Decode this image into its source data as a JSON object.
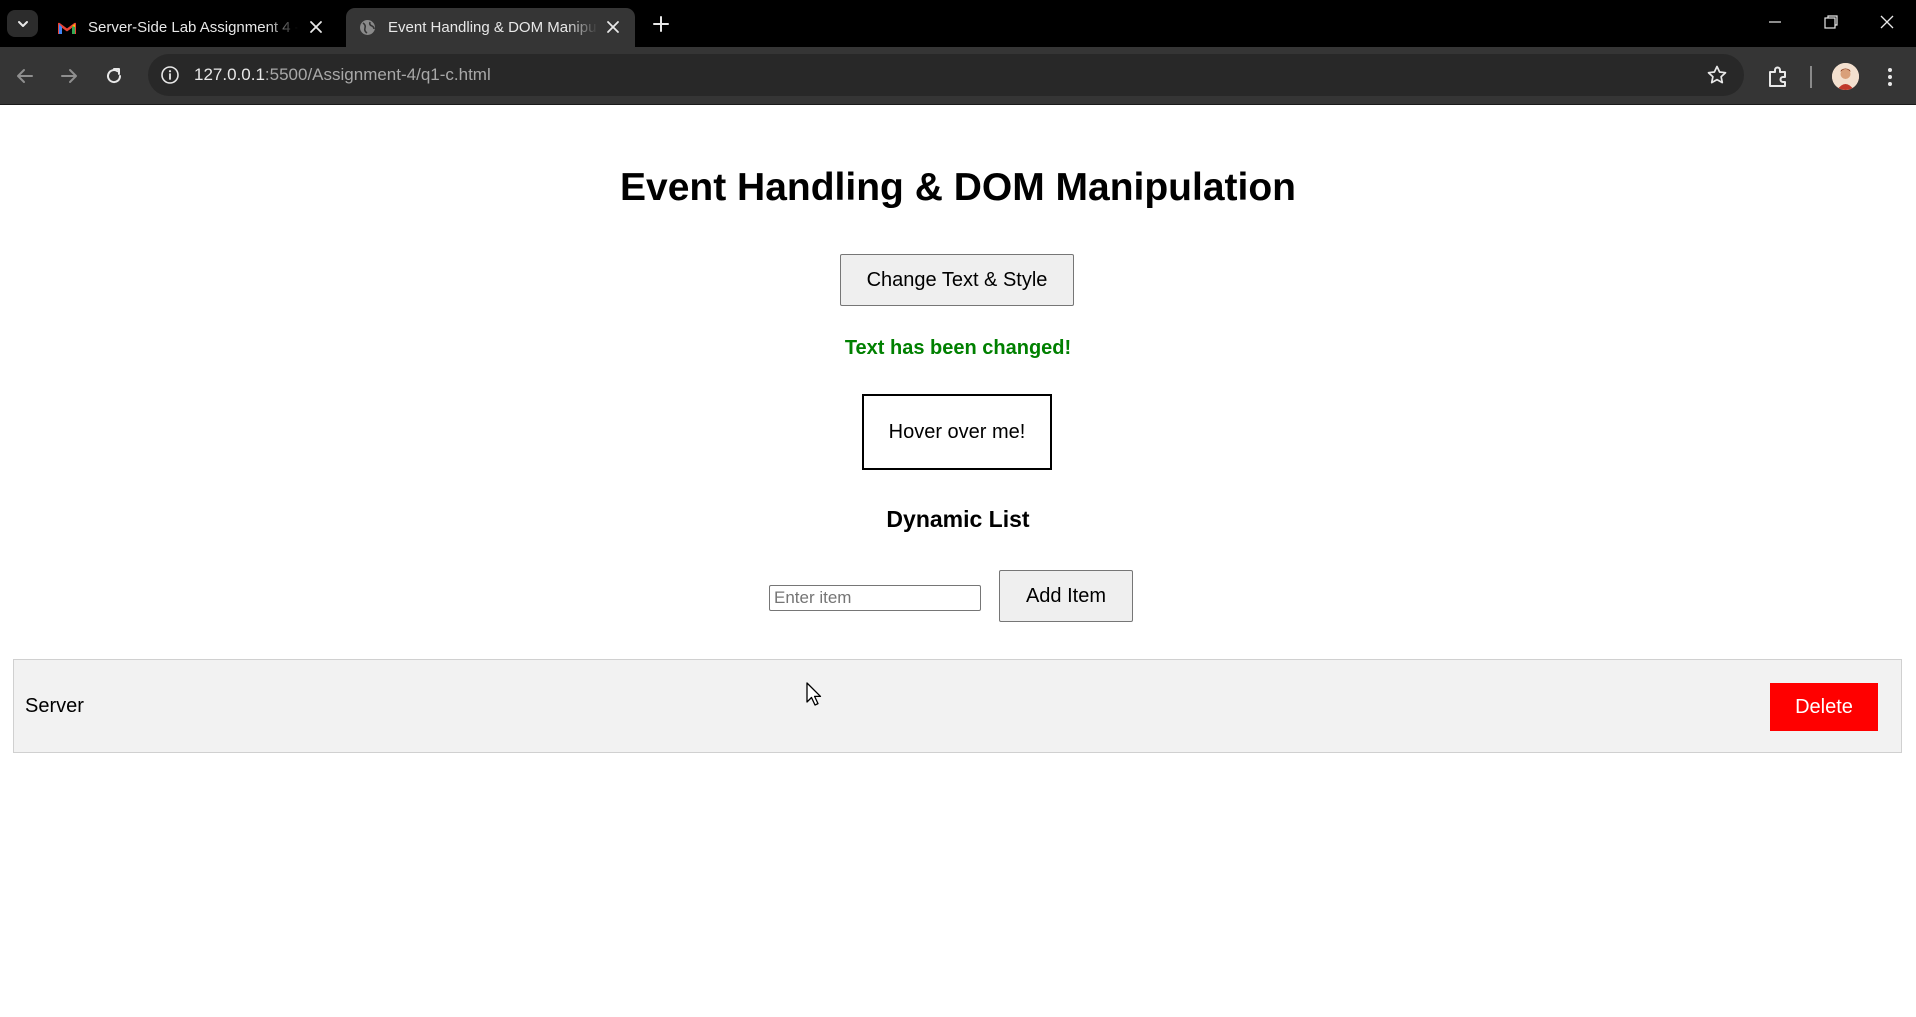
{
  "browser": {
    "tabs": [
      {
        "title": "Server-Side Lab Assignment 4 -",
        "favicon": "gmail-icon",
        "active": false
      },
      {
        "title": "Event Handling & DOM Manipu",
        "favicon": "globe-icon",
        "active": true
      }
    ],
    "address": {
      "host": "127.0.0.1",
      "rest": ":5500/Assignment-4/q1-c.html"
    }
  },
  "page": {
    "heading": "Event Handling & DOM Manipulation",
    "change_button_label": "Change Text & Style",
    "changed_text": "Text has been changed!",
    "hover_box_text": "Hover over me!",
    "list_heading": "Dynamic List",
    "input_placeholder": "Enter item",
    "input_value": "",
    "add_button_label": "Add Item",
    "items": [
      {
        "label": "Server",
        "delete_label": "Delete"
      }
    ]
  },
  "colors": {
    "changed_text": "#008000",
    "delete_button": "#ff0000",
    "list_item_bg": "#f2f2f2",
    "tabstrip_bg": "#000000",
    "toolbar_bg": "#353535"
  }
}
